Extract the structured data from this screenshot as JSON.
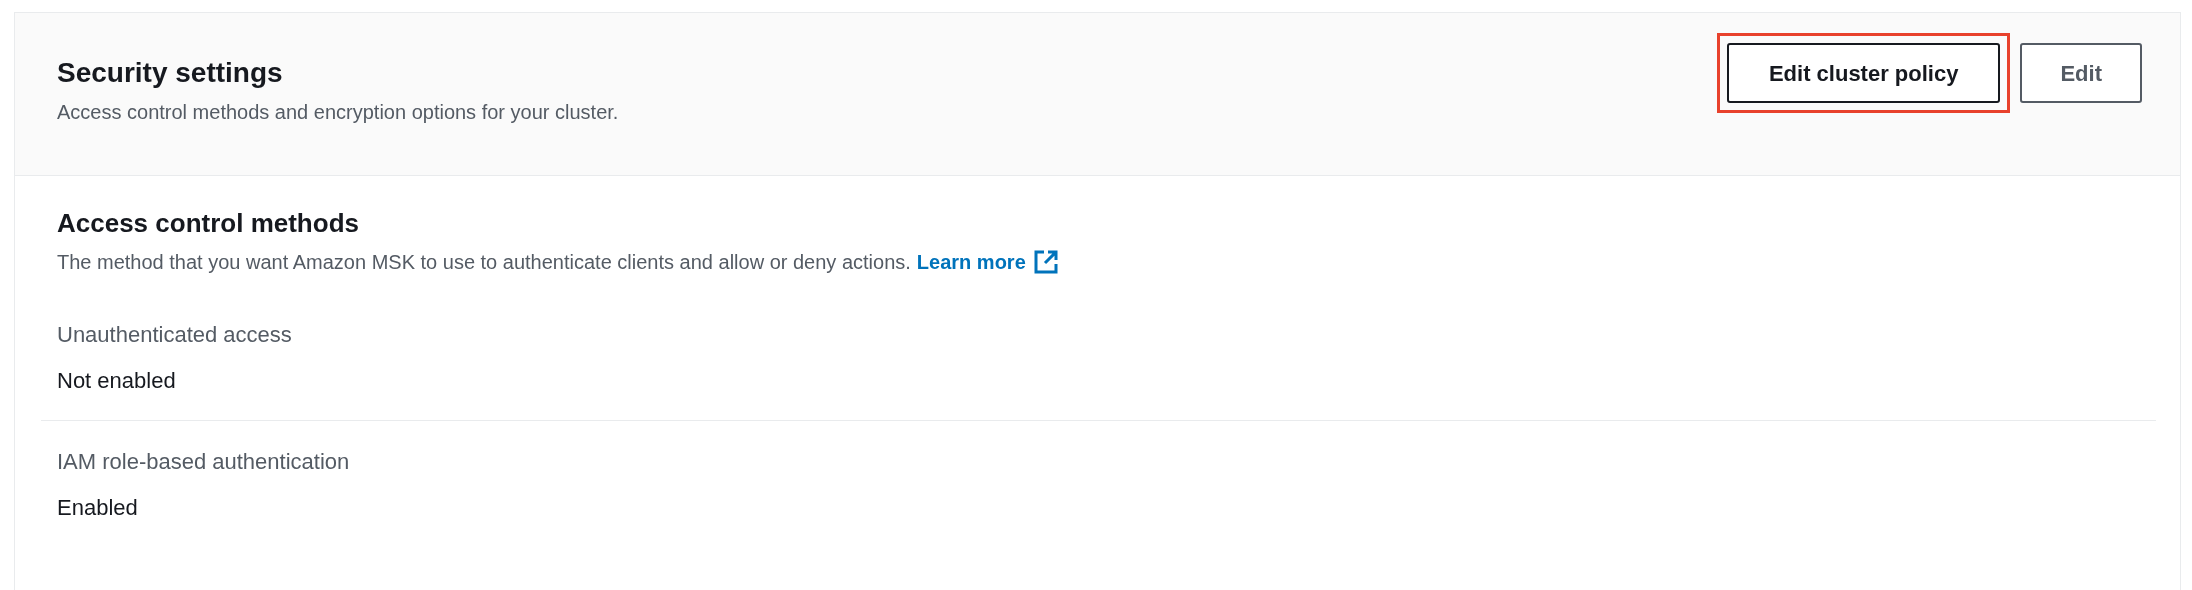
{
  "header": {
    "title": "Security settings",
    "description": "Access control methods and encryption options for your cluster.",
    "buttons": [
      {
        "label": "Edit cluster policy",
        "highlighted": true
      },
      {
        "label": "Edit",
        "highlighted": false
      }
    ]
  },
  "section": {
    "title": "Access control methods",
    "description": "The method that you want Amazon MSK to use to authenticate clients and allow or deny actions.",
    "link": "Learn more",
    "fields": [
      {
        "label": "Unauthenticated access",
        "value": "Not enabled"
      },
      {
        "label": "IAM role-based authentication",
        "value": "Enabled"
      }
    ]
  }
}
